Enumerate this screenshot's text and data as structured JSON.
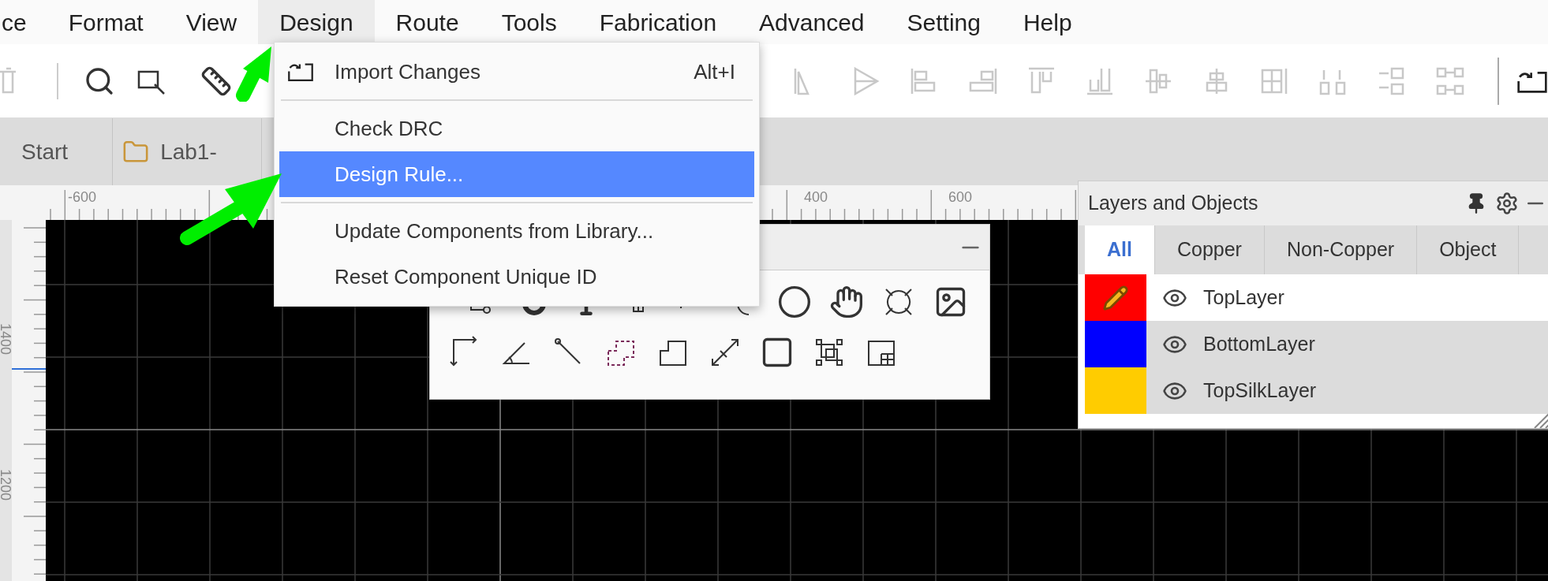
{
  "menu_bar": [
    {
      "label": "ce",
      "selected": false
    },
    {
      "label": "Format",
      "selected": false
    },
    {
      "label": "View",
      "selected": false
    },
    {
      "label": "Design",
      "selected": true
    },
    {
      "label": "Route",
      "selected": false
    },
    {
      "label": "Tools",
      "selected": false
    },
    {
      "label": "Fabrication",
      "selected": false
    },
    {
      "label": "Advanced",
      "selected": false
    },
    {
      "label": "Setting",
      "selected": false
    },
    {
      "label": "Help",
      "selected": false
    }
  ],
  "document_tabs": [
    {
      "label": "Start",
      "kind": "plain"
    },
    {
      "label": "Lab1-",
      "kind": "folder"
    }
  ],
  "rulers": {
    "top": [
      {
        "label": "-600"
      },
      {
        "label": "400"
      },
      {
        "label": "600"
      }
    ],
    "left": [
      {
        "label": "1400"
      },
      {
        "label": "1200"
      }
    ]
  },
  "dropdown_menu": [
    {
      "kind": "item",
      "label": "Import Changes",
      "shortcut": "Alt+I",
      "icon": true,
      "selected": false
    },
    {
      "kind": "separator"
    },
    {
      "kind": "item",
      "label": "Check DRC",
      "selected": false
    },
    {
      "kind": "item",
      "label": "Design Rule...",
      "selected": true
    },
    {
      "kind": "separator"
    },
    {
      "kind": "item",
      "label": "Update Components from Library...",
      "selected": false
    },
    {
      "kind": "item",
      "label": "Reset Component Unique ID",
      "selected": false
    }
  ],
  "layers_panel": {
    "title": "Layers and Objects",
    "tabs": [
      {
        "label": "All",
        "selected": true
      },
      {
        "label": "Copper",
        "selected": false
      },
      {
        "label": "Non-Copper",
        "selected": false
      },
      {
        "label": "Object",
        "selected": false
      }
    ],
    "layers": [
      {
        "name": "TopLayer",
        "color": "#ff0000",
        "selected": true
      },
      {
        "name": "BottomLayer",
        "color": "#0000ff",
        "selected": false
      },
      {
        "name": "TopSilkLayer",
        "color": "#ffcc00",
        "selected": false
      }
    ]
  }
}
